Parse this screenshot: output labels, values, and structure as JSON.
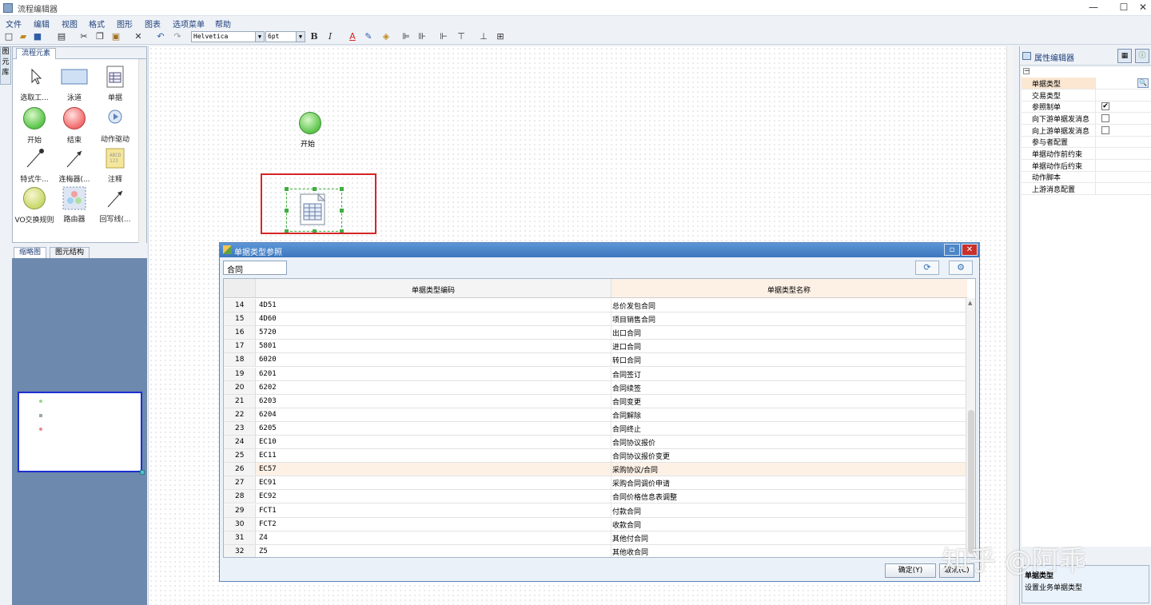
{
  "window": {
    "title": "流程编辑器",
    "controls": [
      "—",
      "☐",
      "✕"
    ]
  },
  "menu": [
    "文件",
    "编辑",
    "视图",
    "格式",
    "图形",
    "图表",
    "选项菜单",
    "帮助"
  ],
  "toolbar": {
    "font": "Helvetica",
    "size": "6pt"
  },
  "sidetab": [
    "图",
    "元",
    "库"
  ],
  "palette": {
    "tab": "流程元素",
    "items": [
      {
        "label": "选取工...",
        "icon": "pointer-icon"
      },
      {
        "label": "泳道",
        "icon": "swimlane-icon"
      },
      {
        "label": "单据",
        "icon": "document-icon"
      },
      {
        "label": "开始",
        "icon": "start-node-icon"
      },
      {
        "label": "结束",
        "icon": "end-node-icon"
      },
      {
        "label": "动作驱动",
        "icon": "action-driver-icon"
      },
      {
        "label": "特式牛...",
        "icon": "custom-connector-icon"
      },
      {
        "label": "连梅器(...",
        "icon": "connector-icon"
      },
      {
        "label": "注释",
        "icon": "note-icon"
      },
      {
        "label": "VO交换规则",
        "icon": "vo-exchange-icon"
      },
      {
        "label": "路由器",
        "icon": "router-icon"
      },
      {
        "label": "回写线(...",
        "icon": "writeback-line-icon"
      }
    ]
  },
  "overview": {
    "tabs": [
      "缩略图",
      "图元结构"
    ]
  },
  "canvas": {
    "start_label": "开始"
  },
  "props": {
    "title": "属性编辑器",
    "rows": [
      {
        "key": "单据类型",
        "type": "text",
        "highlight": true
      },
      {
        "key": "交易类型",
        "type": "text"
      },
      {
        "key": "参照制单",
        "type": "check",
        "checked": "✔"
      },
      {
        "key": "向下游单据发消息",
        "type": "check",
        "checked": ""
      },
      {
        "key": "向上游单据发消息",
        "type": "check",
        "checked": ""
      },
      {
        "key": "参与者配置",
        "type": "text"
      },
      {
        "key": "单据动作前约束",
        "type": "text"
      },
      {
        "key": "单据动作后约束",
        "type": "text"
      },
      {
        "key": "动作脚本",
        "type": "text"
      },
      {
        "key": "上游消息配置",
        "type": "text"
      }
    ],
    "desc_title": "单据类型",
    "desc_text": "设置业务单据类型"
  },
  "dialog": {
    "title": "单据类型参照",
    "search_value": "合同",
    "col_code": "单据类型编码",
    "col_name": "单据类型名称",
    "rows": [
      {
        "n": "14",
        "code": "4D51",
        "name": "总价发包合同"
      },
      {
        "n": "15",
        "code": "4D60",
        "name": "项目销售合同"
      },
      {
        "n": "16",
        "code": "5720",
        "name": "出口合同"
      },
      {
        "n": "17",
        "code": "5801",
        "name": "进口合同"
      },
      {
        "n": "18",
        "code": "6020",
        "name": "转口合同"
      },
      {
        "n": "19",
        "code": "6201",
        "name": "合同签订"
      },
      {
        "n": "20",
        "code": "6202",
        "name": "合同续签"
      },
      {
        "n": "21",
        "code": "6203",
        "name": "合同变更"
      },
      {
        "n": "22",
        "code": "6204",
        "name": "合同解除"
      },
      {
        "n": "23",
        "code": "6205",
        "name": "合同终止"
      },
      {
        "n": "24",
        "code": "EC10",
        "name": "合同协议报价"
      },
      {
        "n": "25",
        "code": "EC11",
        "name": "合同协议报价变更"
      },
      {
        "n": "26",
        "code": "EC57",
        "name": "采购协议/合同",
        "selected": true
      },
      {
        "n": "27",
        "code": "EC91",
        "name": "采购合同调价申请"
      },
      {
        "n": "28",
        "code": "EC92",
        "name": "合同价格信息表调整"
      },
      {
        "n": "29",
        "code": "FCT1",
        "name": "付款合同"
      },
      {
        "n": "30",
        "code": "FCT2",
        "name": "收款合同"
      },
      {
        "n": "31",
        "code": "Z4",
        "name": "其他付合同"
      },
      {
        "n": "32",
        "code": "Z5",
        "name": "其他收合同"
      }
    ],
    "ok_label": "确定(Y)",
    "cancel_label": "取消(C)"
  },
  "watermark": "知乎 @阿乖",
  "colors": {
    "accent_red": "#d62626",
    "title_blue": "#3b76bd",
    "selected_row": "#fdf1e6"
  }
}
